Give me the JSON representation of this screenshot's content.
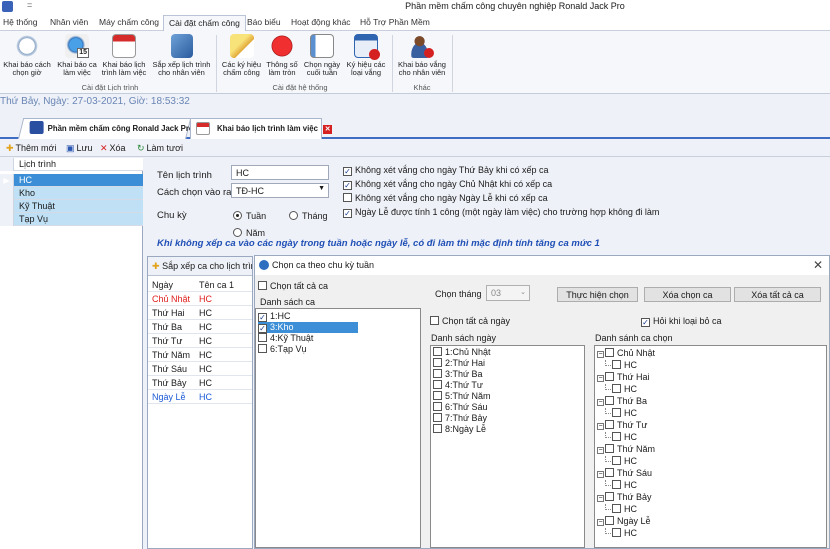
{
  "window": {
    "title": "Phần mềm chấm công chuyên nghiệp Ronald Jack Pro",
    "qat": "="
  },
  "menu": [
    "Hệ thống",
    "Nhân viên",
    "Máy chấm công",
    "Cài đặt chấm công",
    "Báo biểu",
    "Hoạt động khác",
    "Hỗ Trợ Phần Mềm"
  ],
  "ribbon": {
    "buttons": [
      {
        "line1": "Khai báo cách",
        "line2": "chọn giờ"
      },
      {
        "line1": "Khai báo ca",
        "line2": "làm việc"
      },
      {
        "line1": "Khai báo lịch",
        "line2": "trình làm việc"
      },
      {
        "line1": "Sắp xếp lịch trình",
        "line2": "cho nhân viên"
      },
      {
        "line1": "Các ký hiệu",
        "line2": "chấm công"
      },
      {
        "line1": "Thông số",
        "line2": "làm tròn"
      },
      {
        "line1": "Chọn ngày",
        "line2": "cuối tuần"
      },
      {
        "line1": "Ký hiệu các",
        "line2": "loại vắng"
      },
      {
        "line1": "Khai báo vắng",
        "line2": "cho nhân viên"
      }
    ],
    "groups": [
      "Cài đặt Lịch trình",
      "Cài đặt hệ thống",
      "Khác"
    ],
    "calendar_number": "15"
  },
  "datetime": "Thứ Bảy, Ngày: 27-03-2021, Giờ: 18:53:32",
  "tabs": [
    "Phần mềm chấm công Ronald Jack Pro",
    "Khai báo lịch trình làm việc"
  ],
  "toolbar": {
    "add": "Thêm mới",
    "save": "Lưu",
    "delete": "Xóa",
    "refresh": "Làm tươi"
  },
  "schedule_list": {
    "header": "Lịch trình",
    "rows": [
      "HC",
      "Kho",
      "Kỹ Thuật",
      "Tạp Vụ"
    ]
  },
  "form": {
    "name_label": "Tên lịch trình",
    "name_value": "HC",
    "method_label": "Cách chọn vào ra",
    "method_value": "TĐ-HC",
    "cycle_label": "Chu kỳ",
    "cycle_week": "Tuần",
    "cycle_month": "Tháng",
    "cycle_year": "Năm",
    "options": [
      "Không xét vắng cho ngày Thứ Bảy khi có xếp ca",
      "Không xét vắng cho ngày Chủ Nhật khi có xếp ca",
      "Không xét vắng cho ngày Ngày Lễ khi có xếp ca",
      "Ngày Lễ được tính 1 công (một ngày làm việc) cho trường hợp không đi làm"
    ],
    "note": "Khi không xếp ca vào các ngày trong tuần hoặc ngày lễ, có đi làm thì mặc định tính tăng ca mức 1"
  },
  "shift_panel": {
    "toolbar": "Sắp xếp ca cho lịch trình",
    "col_day": "Ngày",
    "col_shift": "Tên ca 1",
    "rows": [
      {
        "day": "Chủ Nhật",
        "shift": "HC",
        "color": "#e02020"
      },
      {
        "day": "Thứ Hai",
        "shift": "HC",
        "color": "#1a1a1a"
      },
      {
        "day": "Thứ Ba",
        "shift": "HC",
        "color": "#1a1a1a"
      },
      {
        "day": "Thứ Tư",
        "shift": "HC",
        "color": "#1a1a1a"
      },
      {
        "day": "Thứ Năm",
        "shift": "HC",
        "color": "#1a1a1a"
      },
      {
        "day": "Thứ Sáu",
        "shift": "HC",
        "color": "#1a1a1a"
      },
      {
        "day": "Thứ Bảy",
        "shift": "HC",
        "color": "#1a1a1a"
      },
      {
        "day": "Ngày Lễ",
        "shift": "HC",
        "color": "#1a5ad6"
      }
    ]
  },
  "dialog": {
    "title": "Chọn ca theo chu kỳ tuần",
    "select_all_shifts": "Chọn tất cả ca",
    "shift_list_label": "Danh sách ca",
    "shifts": [
      "1:HC",
      "3:Kho",
      "4:Kỹ Thuật",
      "6:Tạp Vụ"
    ],
    "month_label": "Chọn tháng",
    "month_value": "03",
    "btn_apply": "Thực hiện chọn",
    "btn_clear": "Xóa chọn ca",
    "btn_clear_all": "Xóa tất cả ca",
    "select_all_days": "Chọn tất cả ngày",
    "ask_remove": "Hỏi khi loại bỏ ca",
    "day_list_label": "Danh sách ngày",
    "days": [
      "1:Chủ Nhật",
      "2:Thứ Hai",
      "3:Thứ Ba",
      "4:Thứ Tư",
      "5:Thứ Năm",
      "6:Thứ Sáu",
      "7:Thứ Bảy",
      "8:Ngày Lễ"
    ],
    "chosen_label": "Danh sánh ca chọn",
    "tree": [
      {
        "day": "Chủ Nhật",
        "shift": "HC"
      },
      {
        "day": "Thứ Hai",
        "shift": "HC"
      },
      {
        "day": "Thứ Ba",
        "shift": "HC"
      },
      {
        "day": "Thứ Tư",
        "shift": "HC"
      },
      {
        "day": "Thứ Năm",
        "shift": "HC"
      },
      {
        "day": "Thứ Sáu",
        "shift": "HC"
      },
      {
        "day": "Thứ Bảy",
        "shift": "HC"
      },
      {
        "day": "Ngày Lễ",
        "shift": "HC"
      }
    ]
  }
}
